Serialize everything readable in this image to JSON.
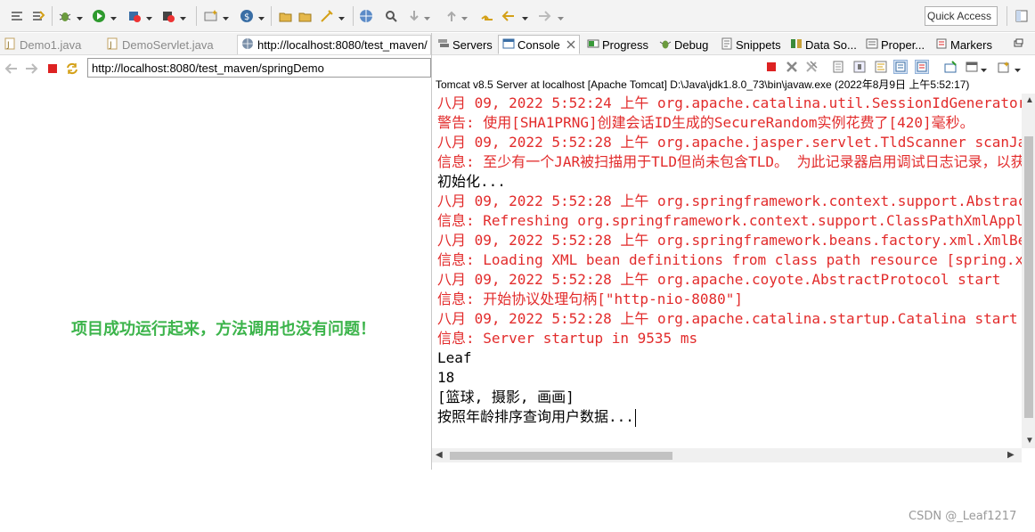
{
  "toolbar": {
    "quick_access": "Quick Access"
  },
  "editor_tabs": [
    {
      "label": "Demo1.java",
      "active": false
    },
    {
      "label": "DemoServlet.java",
      "active": false
    },
    {
      "label": "http://localhost:8080/test_maven/",
      "active": true
    }
  ],
  "browser": {
    "url": "http://localhost:8080/test_maven/springDemo"
  },
  "page_message": "项目成功运行起来，方法调用也没有问题！",
  "view_tabs": [
    {
      "label": "Servers",
      "icon": "servers-icon"
    },
    {
      "label": "Console",
      "icon": "console-icon",
      "active": true
    },
    {
      "label": "Progress",
      "icon": "progress-icon"
    },
    {
      "label": "Debug",
      "icon": "debug-icon"
    },
    {
      "label": "Snippets",
      "icon": "snippets-icon"
    },
    {
      "label": "Data So...",
      "icon": "data-source-icon"
    },
    {
      "label": "Proper...",
      "icon": "properties-icon"
    },
    {
      "label": "Markers",
      "icon": "markers-icon"
    }
  ],
  "console": {
    "title": "Tomcat v8.5 Server at localhost [Apache Tomcat] D:\\Java\\jdk1.8.0_73\\bin\\javaw.exe (2022年8月9日 上午5:52:17)",
    "lines": [
      {
        "text": "八月 09, 2022 5:52:24 上午 org.apache.catalina.util.SessionIdGeneratorBase createSecureRandom",
        "color": "red"
      },
      {
        "text": "警告: 使用[SHA1PRNG]创建会话ID生成的SecureRandom实例花费了[420]毫秒。",
        "color": "red"
      },
      {
        "text": "八月 09, 2022 5:52:28 上午 org.apache.jasper.servlet.TldScanner scanJars",
        "color": "red"
      },
      {
        "text": "信息: 至少有一个JAR被扫描用于TLD但尚未包含TLD。 为此记录器启用调试日志记录，以获取已扫描但未在其中找到TLD的完整JAR列表。",
        "color": "red"
      },
      {
        "text": "初始化...",
        "color": "black"
      },
      {
        "text": "八月 09, 2022 5:52:28 上午 org.springframework.context.support.AbstractApplicationContext prepareRefresh",
        "color": "red"
      },
      {
        "text": "信息: Refreshing org.springframework.context.support.ClassPathXmlApplicationContext",
        "color": "red"
      },
      {
        "text": "八月 09, 2022 5:52:28 上午 org.springframework.beans.factory.xml.XmlBeanDefinitionReader loadBeanDefinitions",
        "color": "red"
      },
      {
        "text": "信息: Loading XML bean definitions from class path resource [spring.xml]",
        "color": "red"
      },
      {
        "text": "八月 09, 2022 5:52:28 上午 org.apache.coyote.AbstractProtocol start",
        "color": "red"
      },
      {
        "text": "信息: 开始协议处理句柄[\"http-nio-8080\"]",
        "color": "red"
      },
      {
        "text": "八月 09, 2022 5:52:28 上午 org.apache.catalina.startup.Catalina start",
        "color": "red"
      },
      {
        "text": "信息: Server startup in 9535 ms",
        "color": "red"
      },
      {
        "text": "Leaf",
        "color": "black"
      },
      {
        "text": "18",
        "color": "black"
      },
      {
        "text": "[篮球, 摄影, 画画]",
        "color": "black"
      },
      {
        "text": "按照年龄排序查询用户数据...",
        "color": "black"
      }
    ]
  },
  "watermark": "CSDN @_Leaf1217",
  "colors": {
    "console_red": "#e22b2b",
    "message_green": "#3cb44b"
  }
}
